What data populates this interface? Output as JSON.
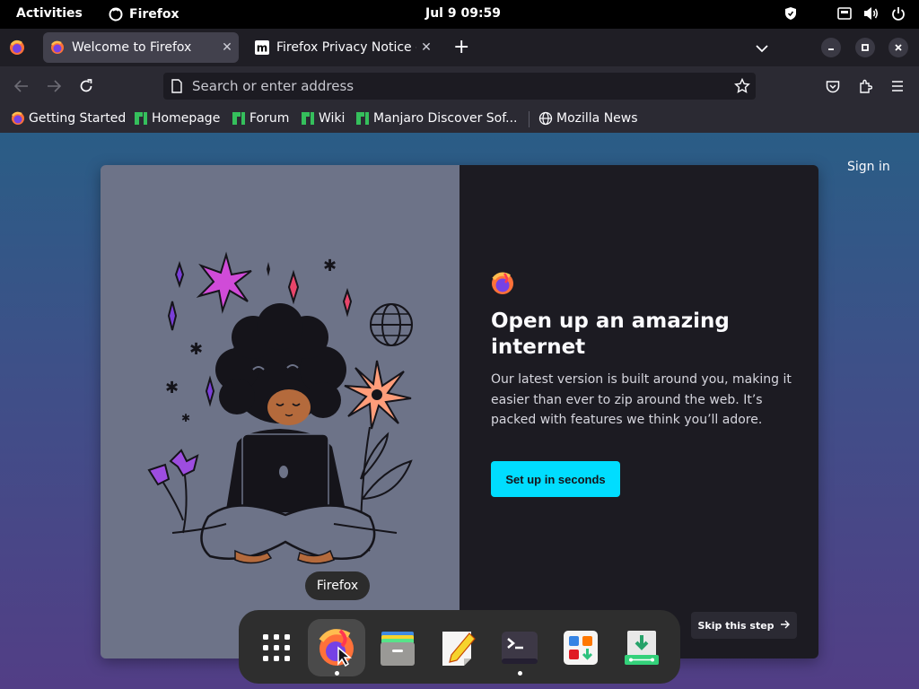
{
  "topbar": {
    "activities": "Activities",
    "app_name": "Firefox",
    "clock": "Jul 9  09:59"
  },
  "tabs": [
    {
      "label": "Welcome to Firefox",
      "active": true
    },
    {
      "label": "Firefox Privacy Notice —",
      "active": false
    }
  ],
  "navbar": {
    "url_placeholder": "Search or enter address"
  },
  "bookmarks": [
    {
      "label": "Getting Started",
      "icon": "firefox-icon"
    },
    {
      "label": "Homepage",
      "icon": "manjaro-icon"
    },
    {
      "label": "Forum",
      "icon": "manjaro-icon"
    },
    {
      "label": "Wiki",
      "icon": "manjaro-icon"
    },
    {
      "label": "Manjaro Discover Sof...",
      "icon": "manjaro-icon"
    },
    {
      "label": "Mozilla News",
      "icon": "globe-icon"
    }
  ],
  "page": {
    "sign_in": "Sign in",
    "heading": "Open up an amazing internet",
    "body": "Our latest version is built around you, making it easier than ever to zip around the web. It’s packed with features we think you’ll adore.",
    "cta": "Set up in seconds",
    "skip": "Skip this step"
  },
  "dock": {
    "tooltip": "Firefox",
    "items": [
      "app-grid",
      "firefox",
      "files",
      "text-editor",
      "terminal",
      "software",
      "installer"
    ]
  },
  "colors": {
    "accent": "#00ddff",
    "tab_active": "#42414d",
    "toolbar": "#2b2a33",
    "card_dark": "#1c1b22"
  }
}
